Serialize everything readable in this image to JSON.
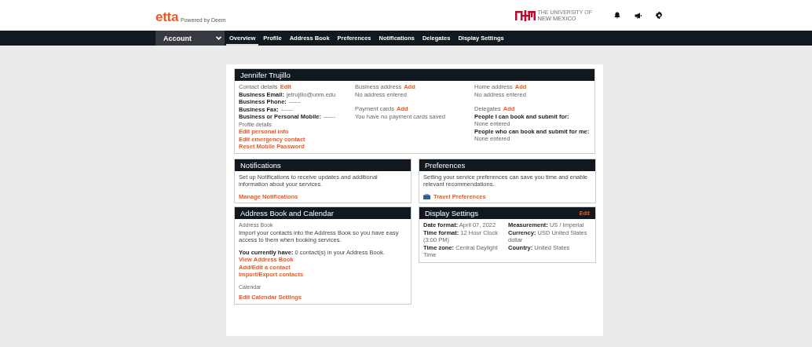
{
  "header": {
    "brand": "etta",
    "tagline": "Powered by Deem",
    "university": [
      "THE UNIVERSITY OF",
      "NEW MEXICO"
    ]
  },
  "nav": {
    "account": "Account",
    "tabs": [
      {
        "label": "Overview",
        "selected": true
      },
      {
        "label": "Profile",
        "selected": false
      },
      {
        "label": "Address Book",
        "selected": false
      },
      {
        "label": "Preferences",
        "selected": false
      },
      {
        "label": "Notifications",
        "selected": false
      },
      {
        "label": "Delegates",
        "selected": false
      },
      {
        "label": "Display Settings",
        "selected": false
      }
    ]
  },
  "profile": {
    "title": "Jennifer Trujillo",
    "contact": {
      "label": "Contact details",
      "action": "Edit",
      "fields": [
        {
          "label": "Business Email:",
          "value": "jetrujillo@unm.edu"
        },
        {
          "label": "Business Phone:",
          "value": "------"
        },
        {
          "label": "Business Fax:",
          "value": "------"
        },
        {
          "label": "Business or Personal Mobile:",
          "value": "------"
        }
      ],
      "profile_label": "Profile details",
      "links": [
        "Edit personal info",
        "Edit emergency contact",
        "Reset Mobile Password"
      ]
    },
    "business_address": {
      "label": "Business address",
      "action": "Add",
      "text": "No address entered"
    },
    "payment_cards": {
      "label": "Payment cards",
      "action": "Add",
      "text": "You have no payment cards saved"
    },
    "home_address": {
      "label": "Home address",
      "action": "Add",
      "text": "No address entered"
    },
    "delegates": {
      "label": "Delegates",
      "action": "Add",
      "groups": [
        {
          "label": "People I can book and submit for:",
          "value": "None entered"
        },
        {
          "label": "People who can book and submit for me:",
          "value": "None entered"
        }
      ]
    }
  },
  "notifications": {
    "title": "Notifications",
    "text": "Set up Notifications to receive updates and additional information about your services.",
    "link": "Manage Notifications"
  },
  "preferences": {
    "title": "Preferences",
    "text": "Setting your service preferences can save you time and enable relevant recommendations.",
    "link": "Travel Preferences"
  },
  "address_book": {
    "title": "Address Book and Calendar",
    "section": "Address Book",
    "text": "Import your contacts into the Address Book so you have easy access to them when booking services.",
    "count": "**You currently have:** 0 contact(s) in your Address Book.",
    "links": [
      "View Address Book",
      "Add/Edit a contact",
      "Import/Export contacts"
    ],
    "calendar_label": "Calendar",
    "calendar_link": "Edit Calendar Settings"
  },
  "display_settings": {
    "title": "Display Settings",
    "action": "Edit",
    "left": [
      {
        "label": "Date format:",
        "value": "April 07, 2022"
      },
      {
        "label": "Time format:",
        "value": "12 Hour Clock (3:00 PM)"
      },
      {
        "label": "Time zone:",
        "value": "Central Daylight Time"
      }
    ],
    "right": [
      {
        "label": "Measurement:",
        "value": "US / Imperial"
      },
      {
        "label": "Currency:",
        "value": "USD  United States dollar"
      },
      {
        "label": "Country:",
        "value": "United States"
      }
    ]
  }
}
